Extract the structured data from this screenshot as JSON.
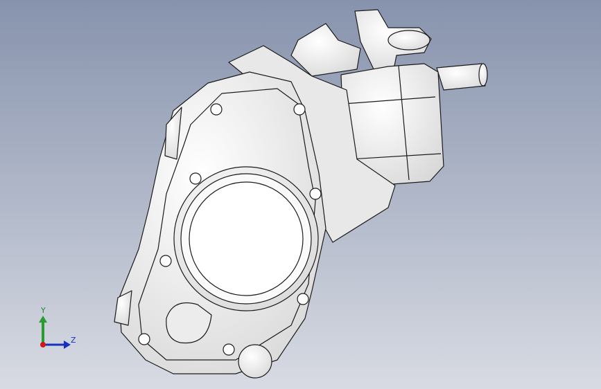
{
  "viewport": {
    "background_top": "#8a97b2",
    "background_bottom": "#d6d9e2",
    "model_fill": "#f4f4f4",
    "model_shade": "#dcdcdc",
    "model_edge": "#1a1a1a"
  },
  "axis_triad": {
    "y_label": "Y",
    "z_label": "Z",
    "y_color": "#2a9a33",
    "z_color": "#1a2fc0",
    "origin_color": "#d01818"
  }
}
